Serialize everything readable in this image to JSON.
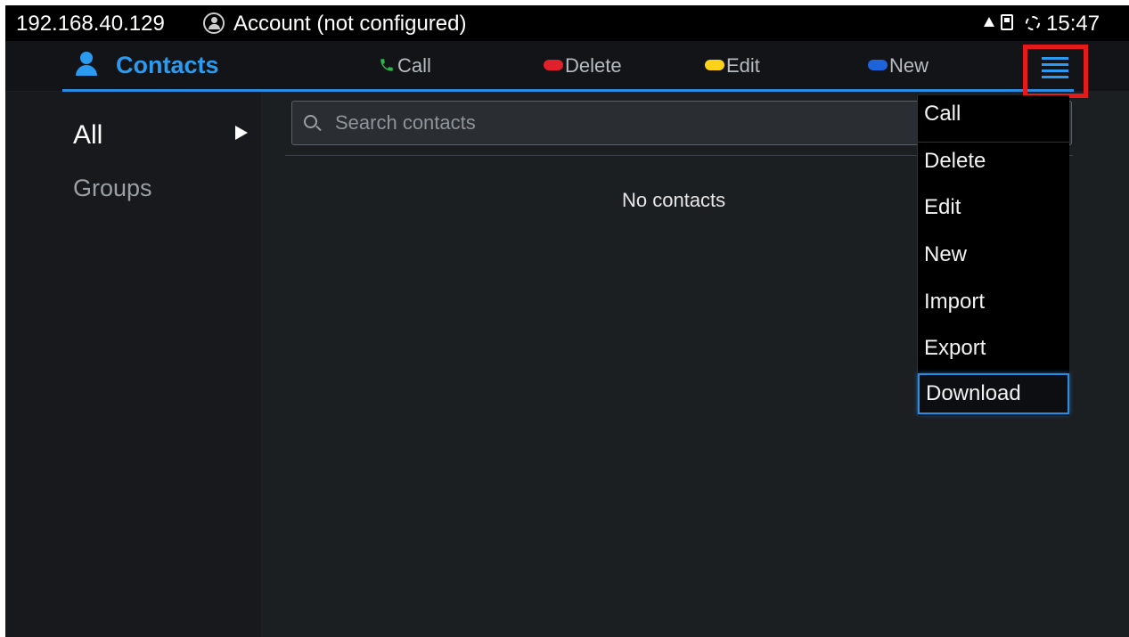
{
  "statusbar": {
    "ip": "192.168.40.129",
    "account": "Account (not configured)",
    "time": "15:47"
  },
  "header": {
    "title": "Contacts",
    "actions": {
      "call": "Call",
      "delete": "Delete",
      "edit": "Edit",
      "new": "New"
    },
    "colors": {
      "accent": "#2a9bf0",
      "call": "#2fb34a",
      "delete": "#e0202a",
      "edit": "#ffd21a",
      "new": "#1e63d9",
      "highlight": "#e51b1b"
    }
  },
  "sidebar": {
    "items": [
      {
        "label": "All",
        "selected": true
      },
      {
        "label": "Groups",
        "selected": false
      }
    ]
  },
  "search": {
    "placeholder": "Search contacts",
    "value": ""
  },
  "main": {
    "empty_text": "No contacts"
  },
  "menu": {
    "items": [
      "Call",
      "Delete",
      "Edit",
      "New",
      "Import",
      "Export",
      "Download"
    ],
    "selected": "Download"
  }
}
